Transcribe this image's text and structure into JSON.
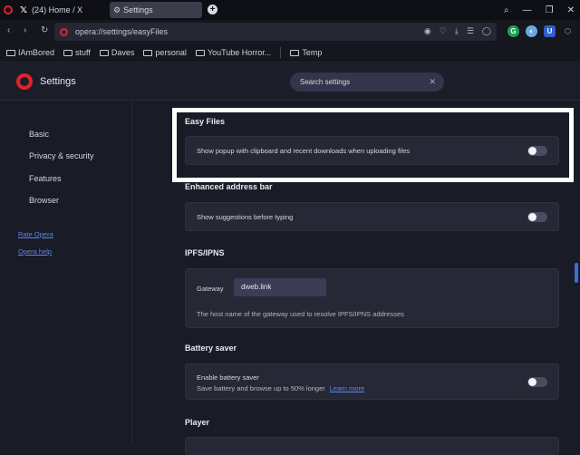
{
  "tabs": [
    {
      "title": "(24) Home / X"
    },
    {
      "title": "Settings"
    }
  ],
  "address": {
    "url": "opera://settings/easyFiles"
  },
  "bookmarks": [
    "IAmBored",
    "stuff",
    "Daves",
    "personal",
    "YouTube Horror...",
    "Temp"
  ],
  "header": {
    "title": "Settings",
    "search_value": "Search settings"
  },
  "sidebar": {
    "items": [
      "Basic",
      "Privacy & security",
      "Features",
      "Browser"
    ],
    "links": [
      "Rate Opera",
      "Opera help"
    ]
  },
  "sections": {
    "easy_files": {
      "title": "Easy Files",
      "setting": "Show popup with clipboard and recent downloads when uploading files",
      "enabled": false
    },
    "address_bar": {
      "title": "Enhanced address bar",
      "setting": "Show suggestions before typing",
      "enabled": false
    },
    "ipfs": {
      "title": "IPFS/IPNS",
      "gateway_label": "Gateway",
      "gateway_value": "dweb.link",
      "description": "The host name of the gateway used to resolve IPFS/IPNS addresses"
    },
    "battery": {
      "title": "Battery saver",
      "setting": "Enable battery saver",
      "description": "Save battery and browse up to 50% longer",
      "learn_more": "Learn more",
      "enabled": false
    },
    "player": {
      "title": "Player"
    }
  },
  "colors": {
    "accent": "#3c6ed8",
    "opera_red": "#e2222a",
    "link": "#5d86e8",
    "annotation": "#ffffff"
  }
}
